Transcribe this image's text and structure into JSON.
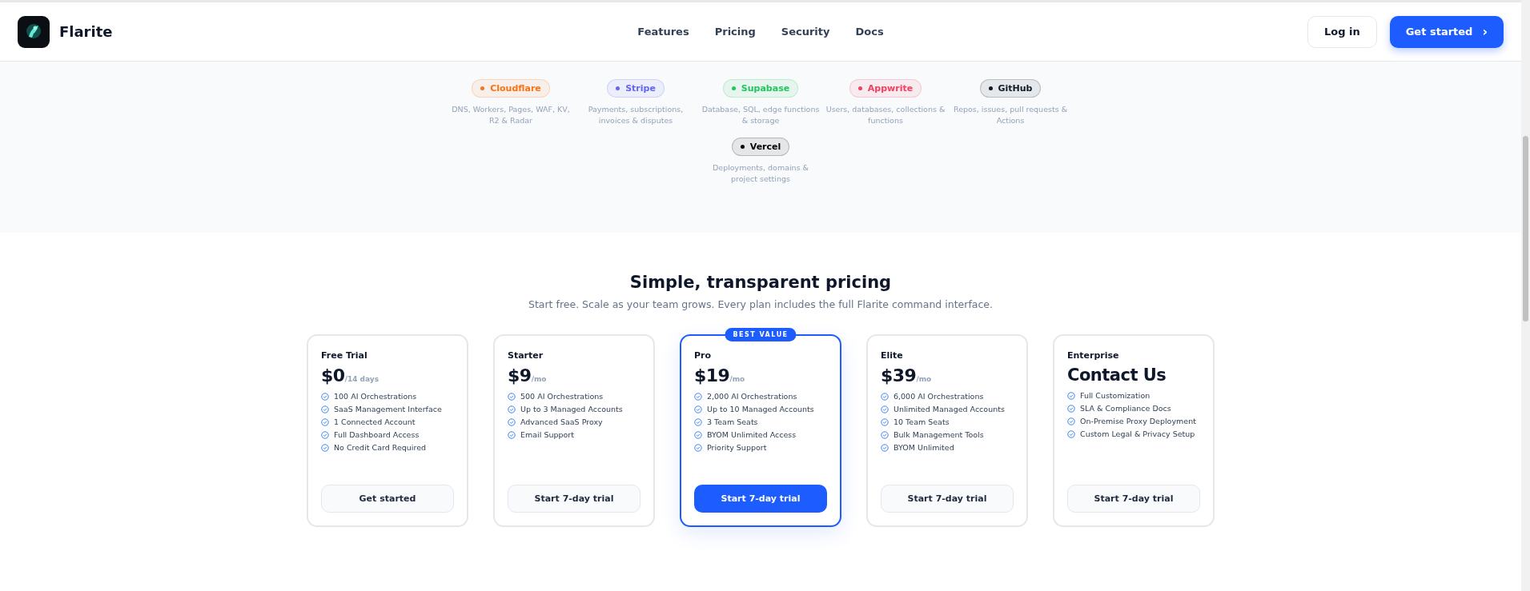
{
  "header": {
    "brand": "Flarite",
    "nav": [
      {
        "label": "Features"
      },
      {
        "label": "Pricing"
      },
      {
        "label": "Security"
      },
      {
        "label": "Docs"
      }
    ],
    "login": "Log in",
    "cta": "Get started",
    "cta_icon": "›"
  },
  "integrations": [
    {
      "name": "Cloudflare",
      "color": "#f97316",
      "description": "DNS, Workers, Pages, WAF, KV, R2 & Radar"
    },
    {
      "name": "Stripe",
      "color": "#6366f1",
      "description": "Payments, subscriptions, invoices & disputes"
    },
    {
      "name": "Supabase",
      "color": "#22c55e",
      "description": "Database, SQL, edge functions & storage"
    },
    {
      "name": "Appwrite",
      "color": "#f43f5e",
      "description": "Users, databases, collections & functions"
    },
    {
      "name": "GitHub",
      "color": "#111827",
      "description": "Repos, issues, pull requests & Actions"
    },
    {
      "name": "Vercel",
      "color": "#000000",
      "description": "Deployments, domains & project settings"
    }
  ],
  "pricing": {
    "title": "Simple, transparent pricing",
    "subtitle": "Start free. Scale as your team grows. Every plan includes the full Flarite command interface.",
    "plans": [
      {
        "name": "Free Trial",
        "price": "$0",
        "period": "/14 days",
        "featured": false,
        "features": [
          "100 AI Orchestrations",
          "SaaS Management Interface",
          "1 Connected Account",
          "Full Dashboard Access",
          "No Credit Card Required"
        ],
        "button": "Get started"
      },
      {
        "name": "Starter",
        "price": "$9",
        "period": "/mo",
        "featured": false,
        "features": [
          "500 AI Orchestrations",
          "Up to 3 Managed Accounts",
          "Advanced SaaS Proxy",
          "Email Support"
        ],
        "button": "Start 7-day trial"
      },
      {
        "name": "Pro",
        "price": "$19",
        "period": "/mo",
        "featured": true,
        "badge": "BEST VALUE",
        "features": [
          "2,000 AI Orchestrations",
          "Up to 10 Managed Accounts",
          "3 Team Seats",
          "BYOM Unlimited Access",
          "Priority Support"
        ],
        "button": "Start 7-day trial"
      },
      {
        "name": "Elite",
        "price": "$39",
        "period": "/mo",
        "featured": false,
        "features": [
          "6,000 AI Orchestrations",
          "Unlimited Managed Accounts",
          "10 Team Seats",
          "Bulk Management Tools",
          "BYOM Unlimited"
        ],
        "button": "Start 7-day trial"
      },
      {
        "name": "Enterprise",
        "price": "Contact Us",
        "featured": false,
        "features": [
          "Full Customization",
          "SLA & Compliance Docs",
          "On-Premise Proxy Deployment",
          "Custom Legal & Privacy Setup"
        ],
        "button": "Start 7-day trial"
      }
    ]
  }
}
